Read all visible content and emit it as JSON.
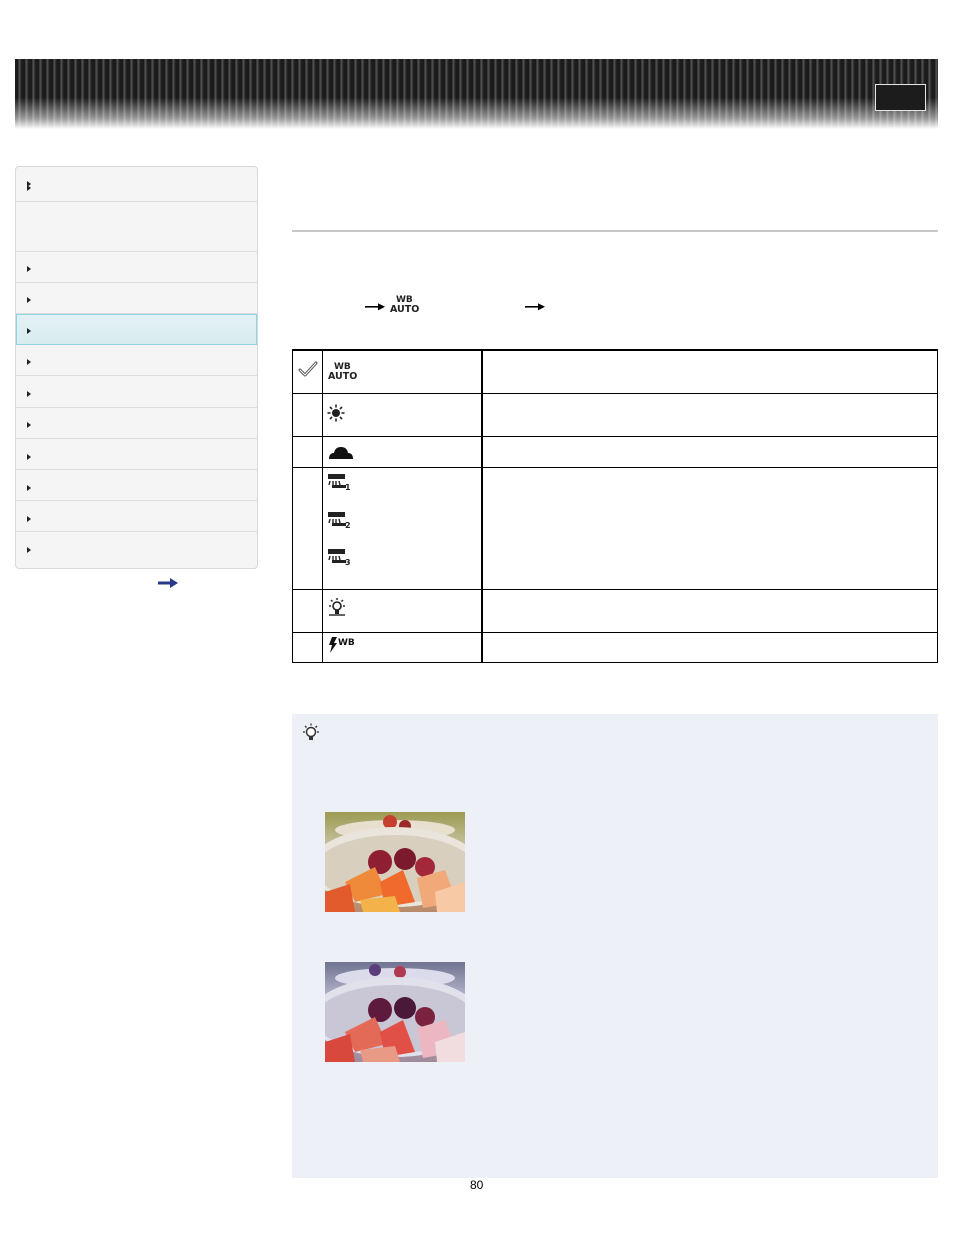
{
  "footer": {
    "page_number": "80"
  },
  "icons": {
    "header_button": "header-button",
    "nav_arrows": "triangle-right-icon",
    "next_page": "arrow-right-icon",
    "setting_path": [
      "arrow-right-icon",
      "wb-auto-icon",
      "arrow-right-icon"
    ],
    "table_rows": [
      [
        "check-icon",
        "wb-auto-icon"
      ],
      [
        "daylight-icon"
      ],
      [
        "cloudy-icon"
      ],
      [
        "fluorescent-1-icon",
        "fluorescent-2-icon",
        "fluorescent-3-icon"
      ],
      [
        "incandescent-icon"
      ],
      [
        "flash-wb-icon"
      ]
    ],
    "hint": "lightbulb-hint-icon"
  },
  "colors": {
    "nav_active_bg": "#dcedf1",
    "nav_active_border": "#8fd3e3",
    "hint_bg": "#edf0f6",
    "arrow_blue": "#2a3a8a"
  },
  "sidebar": {
    "item_count": 12,
    "active_index": 4
  }
}
